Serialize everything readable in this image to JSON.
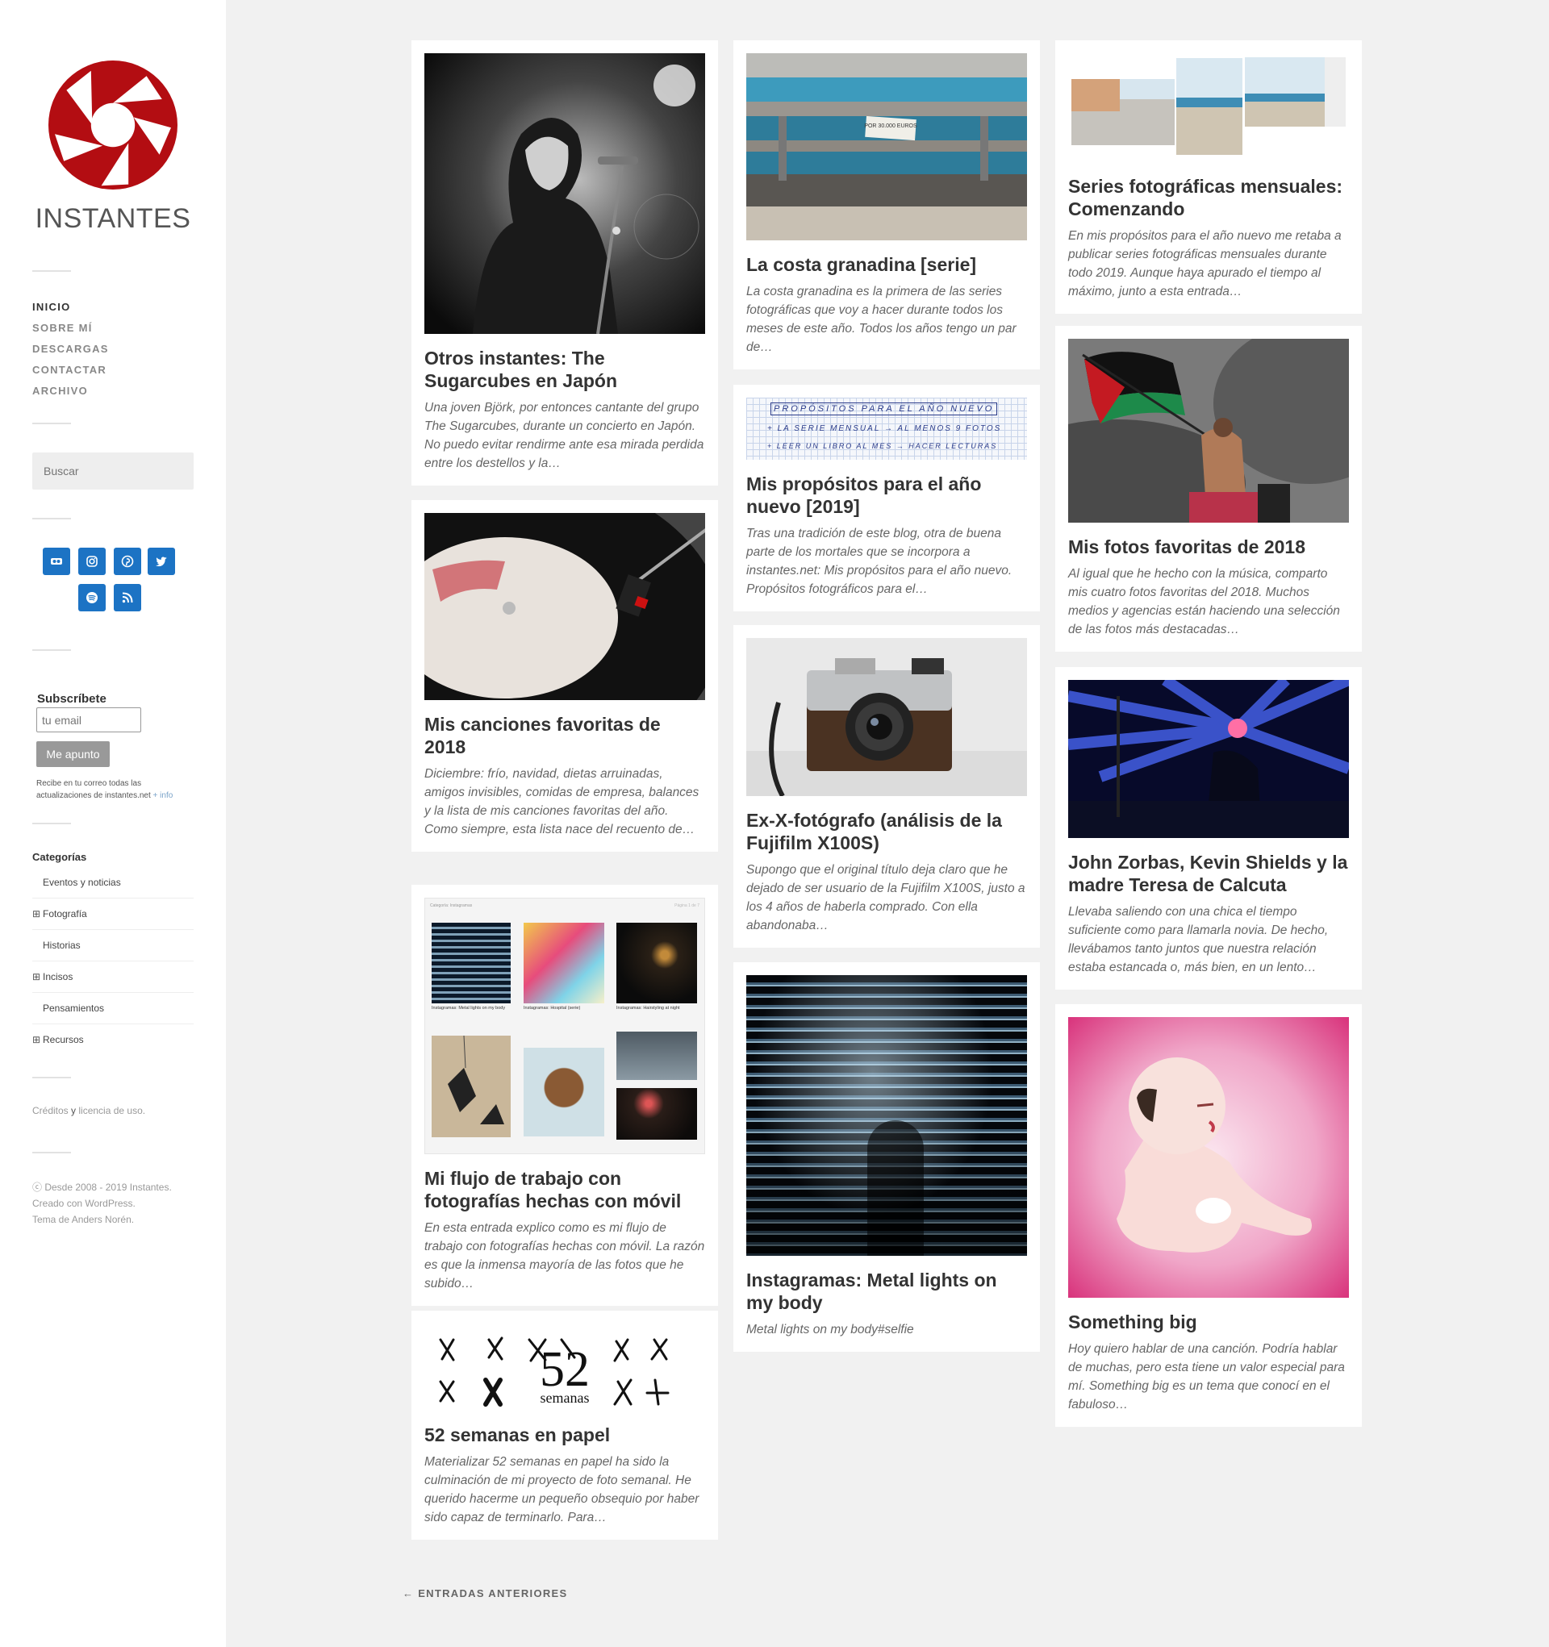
{
  "site": {
    "title": "INSTANTES",
    "brand_color": "#b30d12"
  },
  "nav": {
    "items": [
      {
        "label": "INICIO",
        "active": true
      },
      {
        "label": "SOBRE MÍ",
        "active": false
      },
      {
        "label": "DESCARGAS",
        "active": false
      },
      {
        "label": "CONTACTAR",
        "active": false
      },
      {
        "label": "ARCHIVO",
        "active": false
      }
    ]
  },
  "search": {
    "placeholder": "Buscar"
  },
  "social": {
    "color": "#1c73c4",
    "icons": [
      "flickr-icon",
      "instagram-icon",
      "pinterest-icon",
      "twitter-icon",
      "spotify-icon",
      "rss-icon"
    ]
  },
  "subscribe": {
    "title": "Subscríbete",
    "email_placeholder": "tu email",
    "button": "Me apunto",
    "note": "Recibe en tu correo todas las actualizaciones de instantes.net",
    "more": "+ info"
  },
  "categories": {
    "title": "Categorías",
    "items": [
      {
        "label": "Eventos y noticias",
        "expandable": false
      },
      {
        "label": "Fotografía",
        "expandable": true
      },
      {
        "label": "Historias",
        "expandable": false
      },
      {
        "label": "Incisos",
        "expandable": true
      },
      {
        "label": "Pensamientos",
        "expandable": false
      },
      {
        "label": "Recursos",
        "expandable": true
      }
    ]
  },
  "credits": {
    "link": "Créditos",
    "and": "y",
    "license": "licencia de uso."
  },
  "footer": {
    "line1": "ⓒ Desde 2008 - 2019 Instantes.",
    "line2": "Creado con WordPress.",
    "line3": "Tema de Anders Norén."
  },
  "posts": [
    {
      "title": "Otros instantes: The Sugarcubes en Japón",
      "excerpt": "Una joven Björk, por entonces cantante del grupo  The Sugarcubes, durante un concierto en Japón. No puedo evitar rendirme ante esa mirada perdida entre los destellos y la…"
    },
    {
      "title": "Mis canciones favoritas de 2018",
      "excerpt": "Diciembre: frío, navidad, dietas arruinadas, amigos invisibles, comidas de empresa, balances y la lista de mis canciones favoritas del año. Como siempre, esta lista nace del recuento de…"
    },
    {
      "title": "Mi flujo de trabajo con fotografías hechas con móvil",
      "excerpt": "En esta entrada explico como es mi flujo de trabajo con fotografías hechas con móvil. La razón es que la inmensa mayoría de las fotos que he subido…"
    },
    {
      "title": "52 semanas en papel",
      "excerpt": "Materializar 52 semanas en papel ha sido la culminación de mi proyecto de foto semanal. He querido hacerme un pequeño obsequio por haber sido capaz de terminarlo. Para…"
    },
    {
      "title": "La costa granadina [serie]",
      "excerpt": "La costa granadina es la primera de las series fotográficas que voy a hacer durante todos los meses de este año. Todos los años tengo un par de…"
    },
    {
      "title": "Mis propósitos para el año nuevo [2019]",
      "excerpt": "Tras una tradición de este blog, otra de buena parte de los mortales que se incorpora a instantes.net: Mis propósitos para el año nuevo. Propósitos fotográficos para el…"
    },
    {
      "title": "Ex-X-fotógrafo (análisis de la Fujifilm X100S)",
      "excerpt": "Supongo que el original título deja claro que he dejado de ser usuario de la Fujifilm X100S, justo a los 4 años de haberla comprado. Con ella abandonaba…"
    },
    {
      "title": "Instagramas: Metal lights on my body",
      "excerpt": "Metal lights on my body#selfie"
    },
    {
      "title": "Series fotográficas mensuales: Comenzando",
      "excerpt": "En mis propósitos para el año nuevo me retaba a publicar series fotográficas mensuales durante todo 2019. Aunque haya apurado el tiempo al máximo, junto a esta entrada…"
    },
    {
      "title": "Mis fotos favoritas de 2018",
      "excerpt": "Al igual que he hecho con la música, comparto mis cuatro fotos favoritas del 2018. Muchos medios y agencias están haciendo una selección de las fotos más destacadas…"
    },
    {
      "title": "John Zorbas, Kevin Shields y la madre Teresa de Calcuta",
      "excerpt": "Llevaba saliendo con una chica el tiempo suficiente como para llamarla novia. De hecho, llevábamos tanto juntos que nuestra relación estaba estancada o, más bien, en un lento…"
    },
    {
      "title": "Something big",
      "excerpt": "Hoy quiero hablar de una canción. Podría hablar de muchas, pero esta tiene un valor especial para mí. Something big es un tema que conocí en el fabuloso…"
    }
  ],
  "image_text": {
    "banner": "POR 30.000 EUROS",
    "notebook_1": "PROPÓSITOS PARA EL AÑO NUEVO",
    "notebook_2": "+ LA SERIE MENSUAL → AL MENOS 9 FOTOS",
    "notebook_3": "+ LEER UN LIBRO AL MES → HACER LECTURAS",
    "collage_header": "Categoría: Instagramas",
    "collage_page": "Página 1 de 7",
    "collage_cap1": "Instagramas: Metal lights on my body",
    "collage_cap2": "Instagramas: Hospital (serie)",
    "collage_cap3": "Instagramas: Hairstyling at night",
    "book_52": "52",
    "book_semanas": "semanas"
  },
  "pagination": {
    "older": "← ENTRADAS ANTERIORES"
  }
}
